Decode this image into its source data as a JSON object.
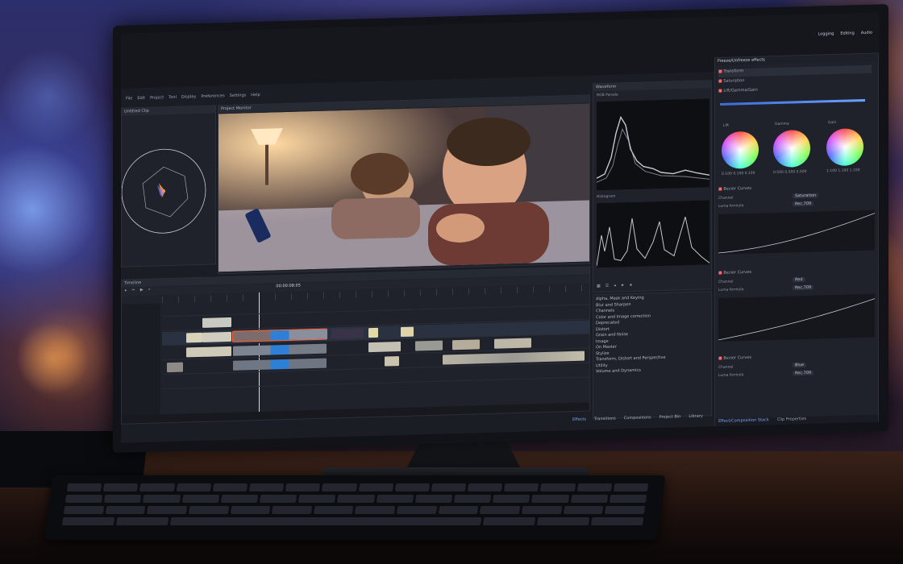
{
  "menu": [
    "File",
    "Edit",
    "Project",
    "Tool",
    "Display",
    "Preferences",
    "Settings",
    "Help"
  ],
  "window_tabs": {
    "logging": "Logging",
    "editing": "Editing",
    "audio": "Audio"
  },
  "panels": {
    "left_top_title": "Untitled Clip",
    "monitor_title": "Project Monitor",
    "scopes_title": "Waveform",
    "timeline_title": "Timeline",
    "effect_stack_title": "Effect/Composition Stack",
    "clip_properties": "Clip Properties"
  },
  "scope_labels": {
    "waveform": "RGB Parade",
    "histogram": "Histogram"
  },
  "effects_categories": [
    "Alpha, Mask and Keying",
    "Blur and Sharpen",
    "Channels",
    "Color and Image correction",
    "Deprecated",
    "Distort",
    "Grain and Noise",
    "Image",
    "On Master",
    "Stylize",
    "Transform, Distort and Perspective",
    "Utility",
    "Volume and Dynamics"
  ],
  "bottom_tabs": [
    "Effects",
    "Transitions",
    "Compositions",
    "Project Bin",
    "Library"
  ],
  "effect_stack": {
    "header": "Freeze/Unfreeze effects",
    "rows": [
      "Transform",
      "Saturation",
      "Lift/Gamma/Gain"
    ],
    "wheels": [
      "Lift",
      "Gamma",
      "Gain"
    ],
    "wheel_values": [
      "0.100  0.100  0.100",
      "0.500  0.500  0.500",
      "1.100  1.100  1.100"
    ],
    "curves": [
      {
        "name": "Bezier Curves",
        "channel": "Saturation",
        "mode": "Rec.709"
      },
      {
        "name": "Bezier Curves",
        "channel": "Red",
        "mode": "Rec.709"
      },
      {
        "name": "Bezier Curves",
        "channel": "Blue",
        "mode": "Rec.709"
      }
    ],
    "curve_labels": {
      "channel": "Channel",
      "formula": "Luma formula"
    }
  },
  "timecode": "00:00:08:05"
}
